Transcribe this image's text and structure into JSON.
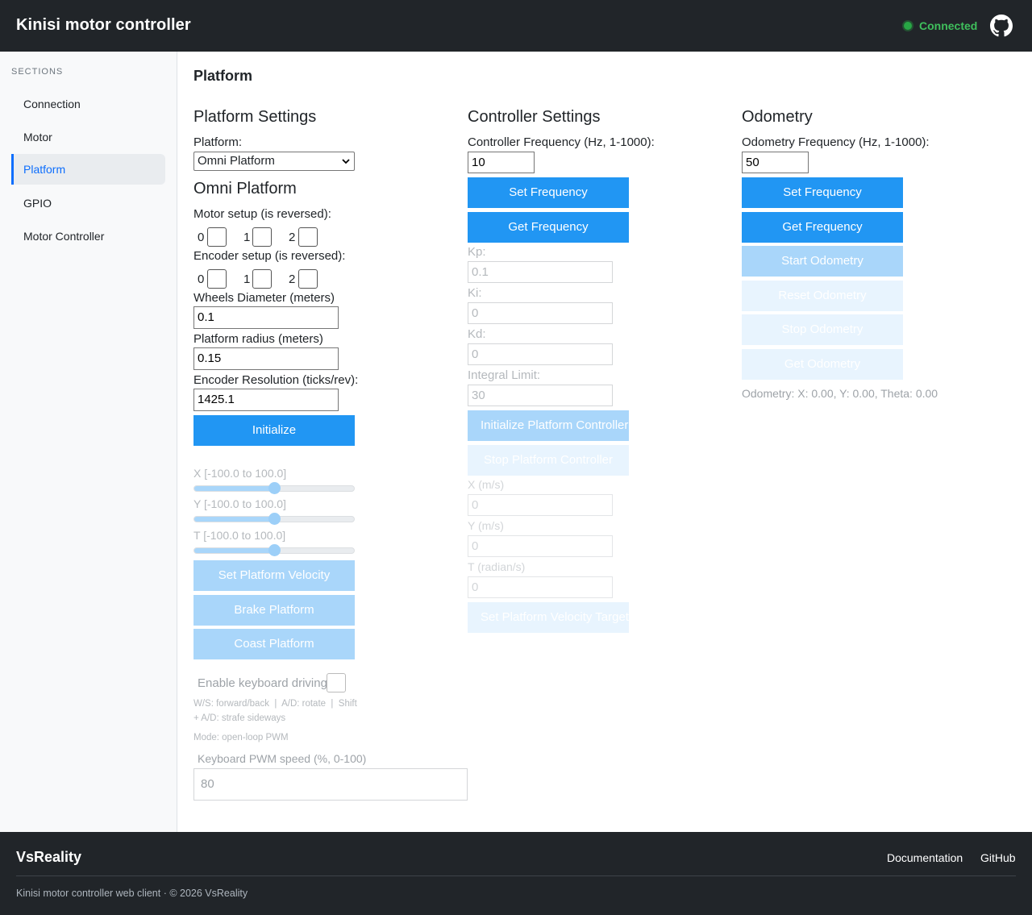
{
  "header": {
    "title": "Kinisi motor controller",
    "status": "Connected",
    "status_color": "#28a745",
    "github_icon": "github-icon"
  },
  "sidebar": {
    "heading": "SECTIONS",
    "items": [
      {
        "label": "Connection"
      },
      {
        "label": "Motor"
      },
      {
        "label": "Platform",
        "active": true
      },
      {
        "label": "GPIO"
      },
      {
        "label": "Motor Controller"
      }
    ]
  },
  "page": {
    "title": "Platform"
  },
  "platform": {
    "title": "Platform Settings",
    "platform_label": "Platform:",
    "platform_value": "Omni Platform",
    "subtitle": "Omni Platform",
    "motor_setup_label": "Motor setup (is reversed):",
    "encoder_setup_label": "Encoder setup (is reversed):",
    "indices": [
      "0",
      "1",
      "2"
    ],
    "wheels_label": "Wheels Diameter (meters)",
    "wheels_value": "0.1",
    "radius_label": "Platform radius (meters)",
    "radius_value": "0.15",
    "resolution_label": "Encoder Resolution (ticks/rev):",
    "resolution_value": "1425.1",
    "initialize": "Initialize",
    "sliders": [
      {
        "label": "X [-100.0 to 100.0]",
        "value": 0.0
      },
      {
        "label": "Y [-100.0 to 100.0]",
        "value": 0.0
      },
      {
        "label": "T [-100.0 to 100.0]",
        "value": 0.0
      }
    ],
    "set_velocity": "Set Platform Velocity",
    "brake": "Brake Platform",
    "coast": "Coast Platform",
    "keyboard_label": "Enable keyboard driving",
    "hint_line1": "W/S: forward/back  |  A/D: rotate  |  Shift",
    "hint_line2": "+ A/D: strafe sideways",
    "mode": "Mode: open-loop PWM",
    "pwm_label": "Keyboard PWM speed (%, 0-100)",
    "pwm_value": "80"
  },
  "controller": {
    "title": "Controller Settings",
    "freq_label": "Controller Frequency (Hz, 1-1000):",
    "freq_value": "10",
    "set_freq": "Set Frequency",
    "get_freq": "Get Frequency",
    "kp_label": "Kp:",
    "kp_value": "0.1",
    "ki_label": "Ki:",
    "ki_value": "0",
    "kd_label": "Kd:",
    "kd_value": "0",
    "limit_label": "Integral Limit:",
    "limit_value": "30",
    "init_controller": "Initialize Platform Controller",
    "stop_controller": "Stop Platform Controller",
    "x_label": "X (m/s)",
    "x_value": "0",
    "y_label": "Y (m/s)",
    "y_value": "0",
    "t_label": "T (radian/s)",
    "t_value": "0",
    "set_target": "Set Platform Velocity Target"
  },
  "odometry": {
    "title": "Odometry",
    "freq_label": "Odometry Frequency (Hz, 1-1000):",
    "freq_value": "50",
    "set_freq": "Set Frequency",
    "get_freq": "Get Frequency",
    "start": "Start Odometry",
    "reset": "Reset Odometry",
    "stop": "Stop Odometry",
    "get": "Get Odometry",
    "readout": "Odometry: X: 0.00, Y: 0.00, Theta: 0.00"
  },
  "footer": {
    "brand": "VsReality",
    "documentation": "Documentation",
    "github": "GitHub",
    "copyright": "Kinisi motor controller web client · © 2026 VsReality"
  }
}
